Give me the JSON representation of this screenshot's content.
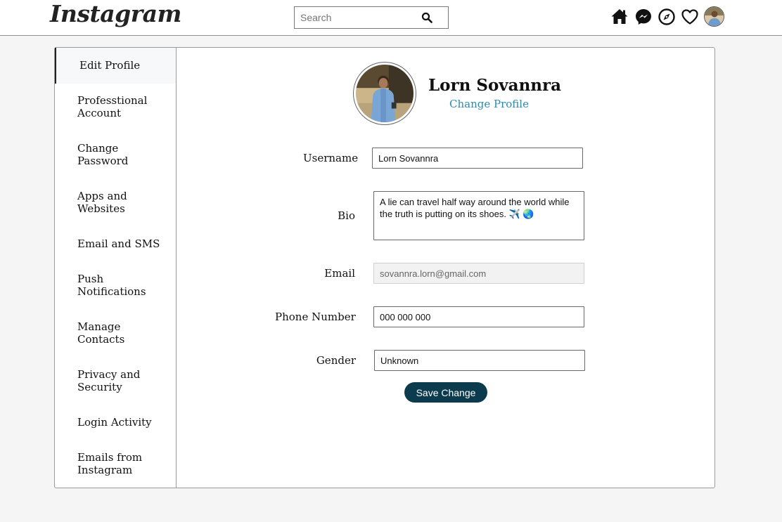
{
  "header": {
    "logo": "Instagram",
    "search": {
      "placeholder": "Search",
      "value": ""
    },
    "icons": [
      "home-icon",
      "messenger-icon",
      "compass-icon",
      "heart-icon",
      "avatar"
    ]
  },
  "sidebar": {
    "items": [
      {
        "label": "Edit Profile",
        "active": true
      },
      {
        "label": "Professtional Account"
      },
      {
        "label": "Change Password"
      },
      {
        "label": "Apps and Websites"
      },
      {
        "label": "Email and SMS"
      },
      {
        "label": "Push Notifications"
      },
      {
        "label": "Manage Contacts"
      },
      {
        "label": "Privacy and Security"
      },
      {
        "label": "Login Activity"
      },
      {
        "label": "Emails from Instagram"
      }
    ]
  },
  "profile": {
    "name": "Lorn Sovannra",
    "change_label": "Change Profile"
  },
  "form": {
    "username_label": "Username",
    "username_value": "Lorn Sovannra",
    "bio_label": "Bio",
    "bio_value": "A lie can travel half way around the world while the truth is putting on its shoes. ✈️ 🌏",
    "email_label": "Email",
    "email_value": "sovannra.lorn@gmail.com",
    "phone_label": "Phone Number",
    "phone_value": "000 000 000",
    "gender_label": "Gender",
    "gender_value": "Unknown",
    "save_label": "Save Change"
  },
  "colors": {
    "accent_link": "#2d8ab0",
    "save_button": "#0c3b4d"
  }
}
